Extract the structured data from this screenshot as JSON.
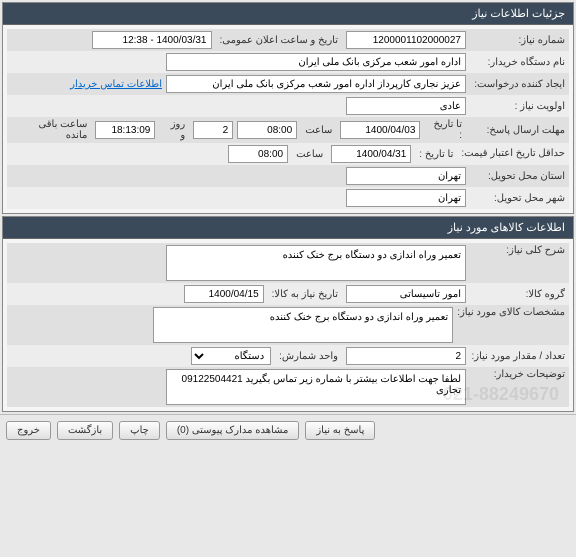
{
  "panel1": {
    "title": "جزئیات اطلاعات نیاز",
    "reqNoLabel": "شماره نیاز:",
    "reqNo": "1200001102000027",
    "pubDateLabel": "تاریخ و ساعت اعلان عمومی:",
    "pubDate": "1400/03/31 - 12:38",
    "buyerLabel": "نام دستگاه خریدار:",
    "buyer": "اداره امور شعب مرکزی بانک ملی ایران",
    "creatorLabel": "ایجاد کننده درخواست:",
    "creator": "عزیز نجاری کارپرداز اداره امور شعب مرکزی بانک ملی ایران",
    "contactLink": "اطلاعات تماس خریدار",
    "priorityLabel": "اولویت نیاز :",
    "priority": "عادی",
    "deadlineLabel": "مهلت ارسال پاسخ:",
    "toDateLabel": "تا تاریخ :",
    "toDate": "1400/04/03",
    "timeLabel": "ساعت",
    "time1": "08:00",
    "daysLeft": "2",
    "dayAnd": "روز و",
    "hoursLeft": "18:13:09",
    "hoursLeftLabel": "ساعت باقی مانده",
    "minValidLabel": "حداقل تاریخ اعتبار قیمت:",
    "minValidToLabel": "تا تاریخ :",
    "minValidDate": "1400/04/31",
    "time2": "08:00",
    "provinceLabel": "استان محل تحویل:",
    "province": "تهران",
    "cityLabel": "شهر محل تحویل:",
    "city": "تهران"
  },
  "panel2": {
    "title": "اطلاعات کالاهای مورد نیاز",
    "descLabel": "شرح کلی نیاز:",
    "desc": "تعمیر وراه اندازی دو دستگاه برج خنک کننده",
    "groupLabel": "گروه کالا:",
    "group": "امور تاسیساتی",
    "delivDateLabel": "تاریخ نیاز به کالا:",
    "delivDate": "1400/04/15",
    "specLabel": "مشخصات کالای مورد نیاز:",
    "spec": "تعمیر وراه اندازی دو دستگاه برج خنک کننده",
    "qtyLabel": "تعداد / مقدار مورد نیاز:",
    "qty": "2",
    "unitLabel": "واحد شمارش:",
    "unit": "دستگاه",
    "noteLabel": "توضیحات خریدار:",
    "note": "لطفا جهت اطلاعات بیشتر با شماره زیر تماس بگیرید 09122504421\nتجاری",
    "watermark": "021-88249670"
  },
  "buttons": {
    "respond": "پاسخ به نیاز",
    "attachments": "مشاهده مدارک پیوستی (0)",
    "print": "چاپ",
    "back": "بازگشت",
    "exit": "خروج"
  }
}
